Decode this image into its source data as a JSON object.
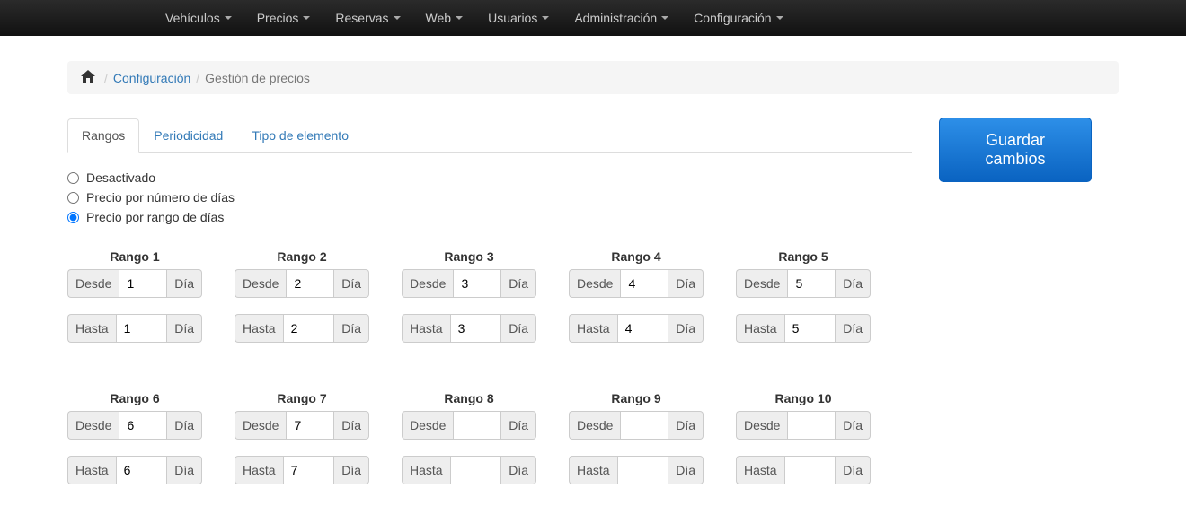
{
  "nav": {
    "items": [
      "Vehículos",
      "Precios",
      "Reservas",
      "Web",
      "Usuarios",
      "Administración",
      "Configuración"
    ]
  },
  "breadcrumb": {
    "link1": "Configuración",
    "active": "Gestión de precios"
  },
  "tabs": {
    "rangos": "Rangos",
    "periodicidad": "Periodicidad",
    "tipo": "Tipo de elemento"
  },
  "radios": {
    "desactivado": "Desactivado",
    "por_numero": "Precio por número de días",
    "por_rango": "Precio por rango de días"
  },
  "labels": {
    "desde": "Desde",
    "hasta": "Hasta",
    "dia": "Día",
    "rango_prefix": "Rango"
  },
  "ranges": [
    {
      "n": "1",
      "desde": "1",
      "hasta": "1"
    },
    {
      "n": "2",
      "desde": "2",
      "hasta": "2"
    },
    {
      "n": "3",
      "desde": "3",
      "hasta": "3"
    },
    {
      "n": "4",
      "desde": "4",
      "hasta": "4"
    },
    {
      "n": "5",
      "desde": "5",
      "hasta": "5"
    },
    {
      "n": "6",
      "desde": "6",
      "hasta": "6"
    },
    {
      "n": "7",
      "desde": "7",
      "hasta": "7"
    },
    {
      "n": "8",
      "desde": "",
      "hasta": ""
    },
    {
      "n": "9",
      "desde": "",
      "hasta": ""
    },
    {
      "n": "10",
      "desde": "",
      "hasta": ""
    }
  ],
  "actions": {
    "guardar_l1": "Guardar",
    "guardar_l2": "cambios"
  }
}
